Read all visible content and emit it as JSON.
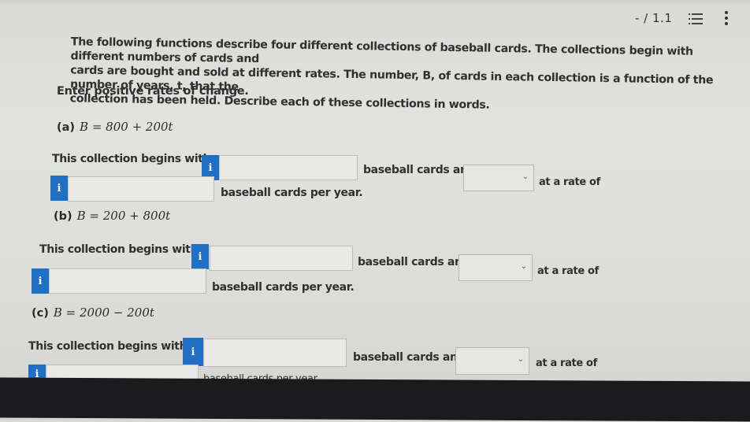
{
  "toolbar": {
    "question_number": "- / 1.1",
    "list_icon": "list-icon",
    "more_icon": "more-vertical-icon"
  },
  "intro": {
    "line1": "The following functions describe four different collections of baseball cards. The collections begin with different numbers of cards and",
    "line2": "cards are bought and sold at different rates. The number, B, of cards in each collection is a function of the number of years, t, that the",
    "line3": "collection has been held. Describe each of these collections in words."
  },
  "instruction": "Enter positive rates of change.",
  "parts": [
    {
      "label": "(a)",
      "equation": "B = 800 + 200t",
      "begins_text": "This collection begins with",
      "cards_and_text": "baseball cards and",
      "rate_text": "at a rate of",
      "per_year_text": "baseball cards per year.",
      "initial_value": "",
      "rate_value": "",
      "direction_selected": ""
    },
    {
      "label": "(b)",
      "equation": "B = 200 + 800t",
      "begins_text": "This collection begins with",
      "cards_and_text": "baseball cards and",
      "rate_text": "at a rate of",
      "per_year_text": "baseball cards per year.",
      "initial_value": "",
      "rate_value": "",
      "direction_selected": ""
    },
    {
      "label": "(c)",
      "equation": "B = 2000 − 200t",
      "begins_text": "This collection begins with",
      "cards_and_text": "baseball cards and",
      "rate_text": "at a rate of",
      "per_year_text": "baseball cards per year",
      "initial_value": "",
      "rate_value": "",
      "direction_selected": ""
    }
  ],
  "info_icon_glyph": "i",
  "chevron_glyph": "⌄",
  "colors": {
    "info_blue": "#1f6fc4"
  }
}
